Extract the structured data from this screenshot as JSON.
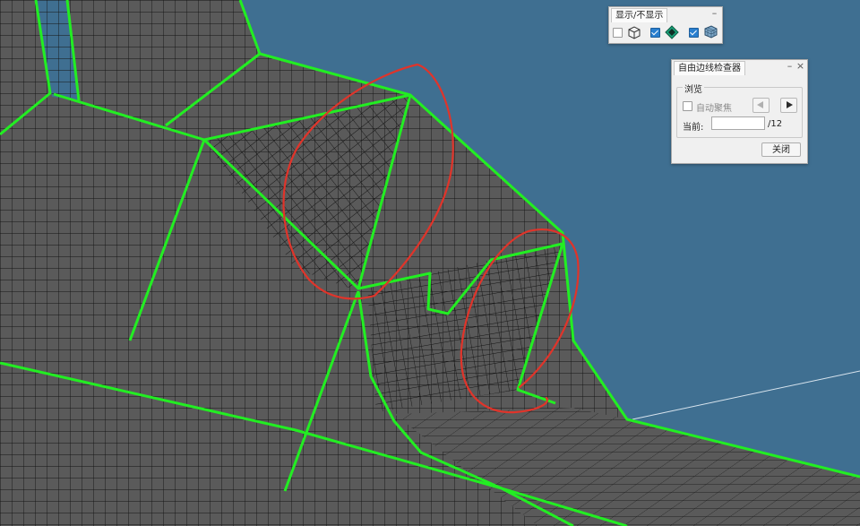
{
  "colors": {
    "background": "#3f6f91",
    "mesh_fill": "#5a5a5a",
    "mesh_line": "#151515",
    "free_edge": "#22ee22",
    "annotation": "#e0342a"
  },
  "display_panel": {
    "title": "显示/不显示",
    "minimize_icon": "–",
    "toggles": [
      {
        "icon": "wireframe-cube-icon",
        "checked": false
      },
      {
        "icon": "shaded-part-icon",
        "checked": true
      },
      {
        "icon": "mesh-cube-icon",
        "checked": true
      }
    ]
  },
  "free_edge_checker": {
    "title": "自由边线检查器",
    "minimize_icon": "–",
    "close_icon": "×",
    "browse_group_label": "浏览",
    "auto_focus_label": "自动聚焦",
    "auto_focus_checked": false,
    "current_label": "当前:",
    "current_value": "",
    "total_label": "/12",
    "close_button_label": "关闭"
  }
}
